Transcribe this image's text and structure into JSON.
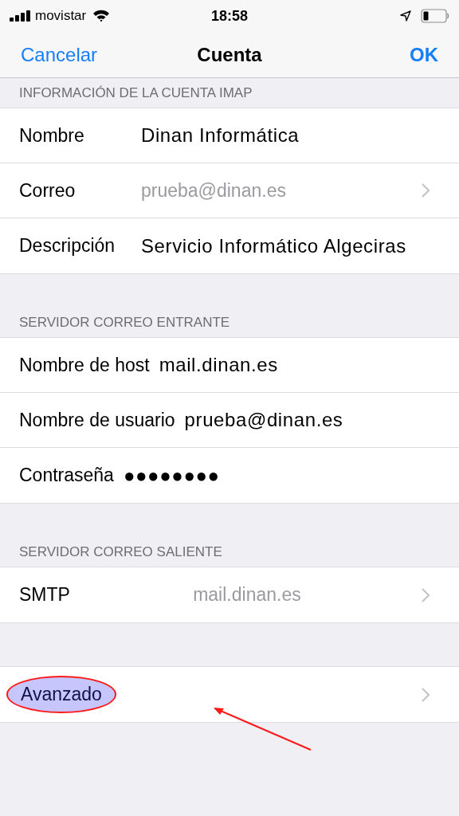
{
  "status_bar": {
    "carrier": "movistar",
    "time": "18:58"
  },
  "nav": {
    "cancel": "Cancelar",
    "title": "Cuenta",
    "ok": "OK"
  },
  "sections": [
    {
      "header": "INFORMACIÓN DE LA CUENTA IMAP",
      "label_column": true,
      "rows": [
        {
          "kind": "field",
          "label": "Nombre",
          "value": "Dinan Informática"
        },
        {
          "kind": "link",
          "label": "Correo",
          "value": "prueba@dinan.es"
        },
        {
          "kind": "field",
          "label": "Descripción",
          "value": "Servicio Informático Algeciras"
        }
      ]
    },
    {
      "header": "SERVIDOR CORREO ENTRANTE",
      "label_column": false,
      "rows": [
        {
          "kind": "field",
          "label": "Nombre de host",
          "value": "mail.dinan.es"
        },
        {
          "kind": "field",
          "label": "Nombre de usuario",
          "value": "prueba@dinan.es"
        },
        {
          "kind": "field",
          "label": "Contraseña",
          "value": "●●●●●●●●"
        }
      ]
    },
    {
      "header": "SERVIDOR CORREO SALIENTE",
      "label_column": false,
      "rows": [
        {
          "kind": "link",
          "label": "SMTP",
          "value": "mail.dinan.es"
        }
      ]
    },
    {
      "label_column": false,
      "rows": [
        {
          "kind": "link",
          "label": "Avanzado",
          "annotated": true
        }
      ]
    }
  ]
}
